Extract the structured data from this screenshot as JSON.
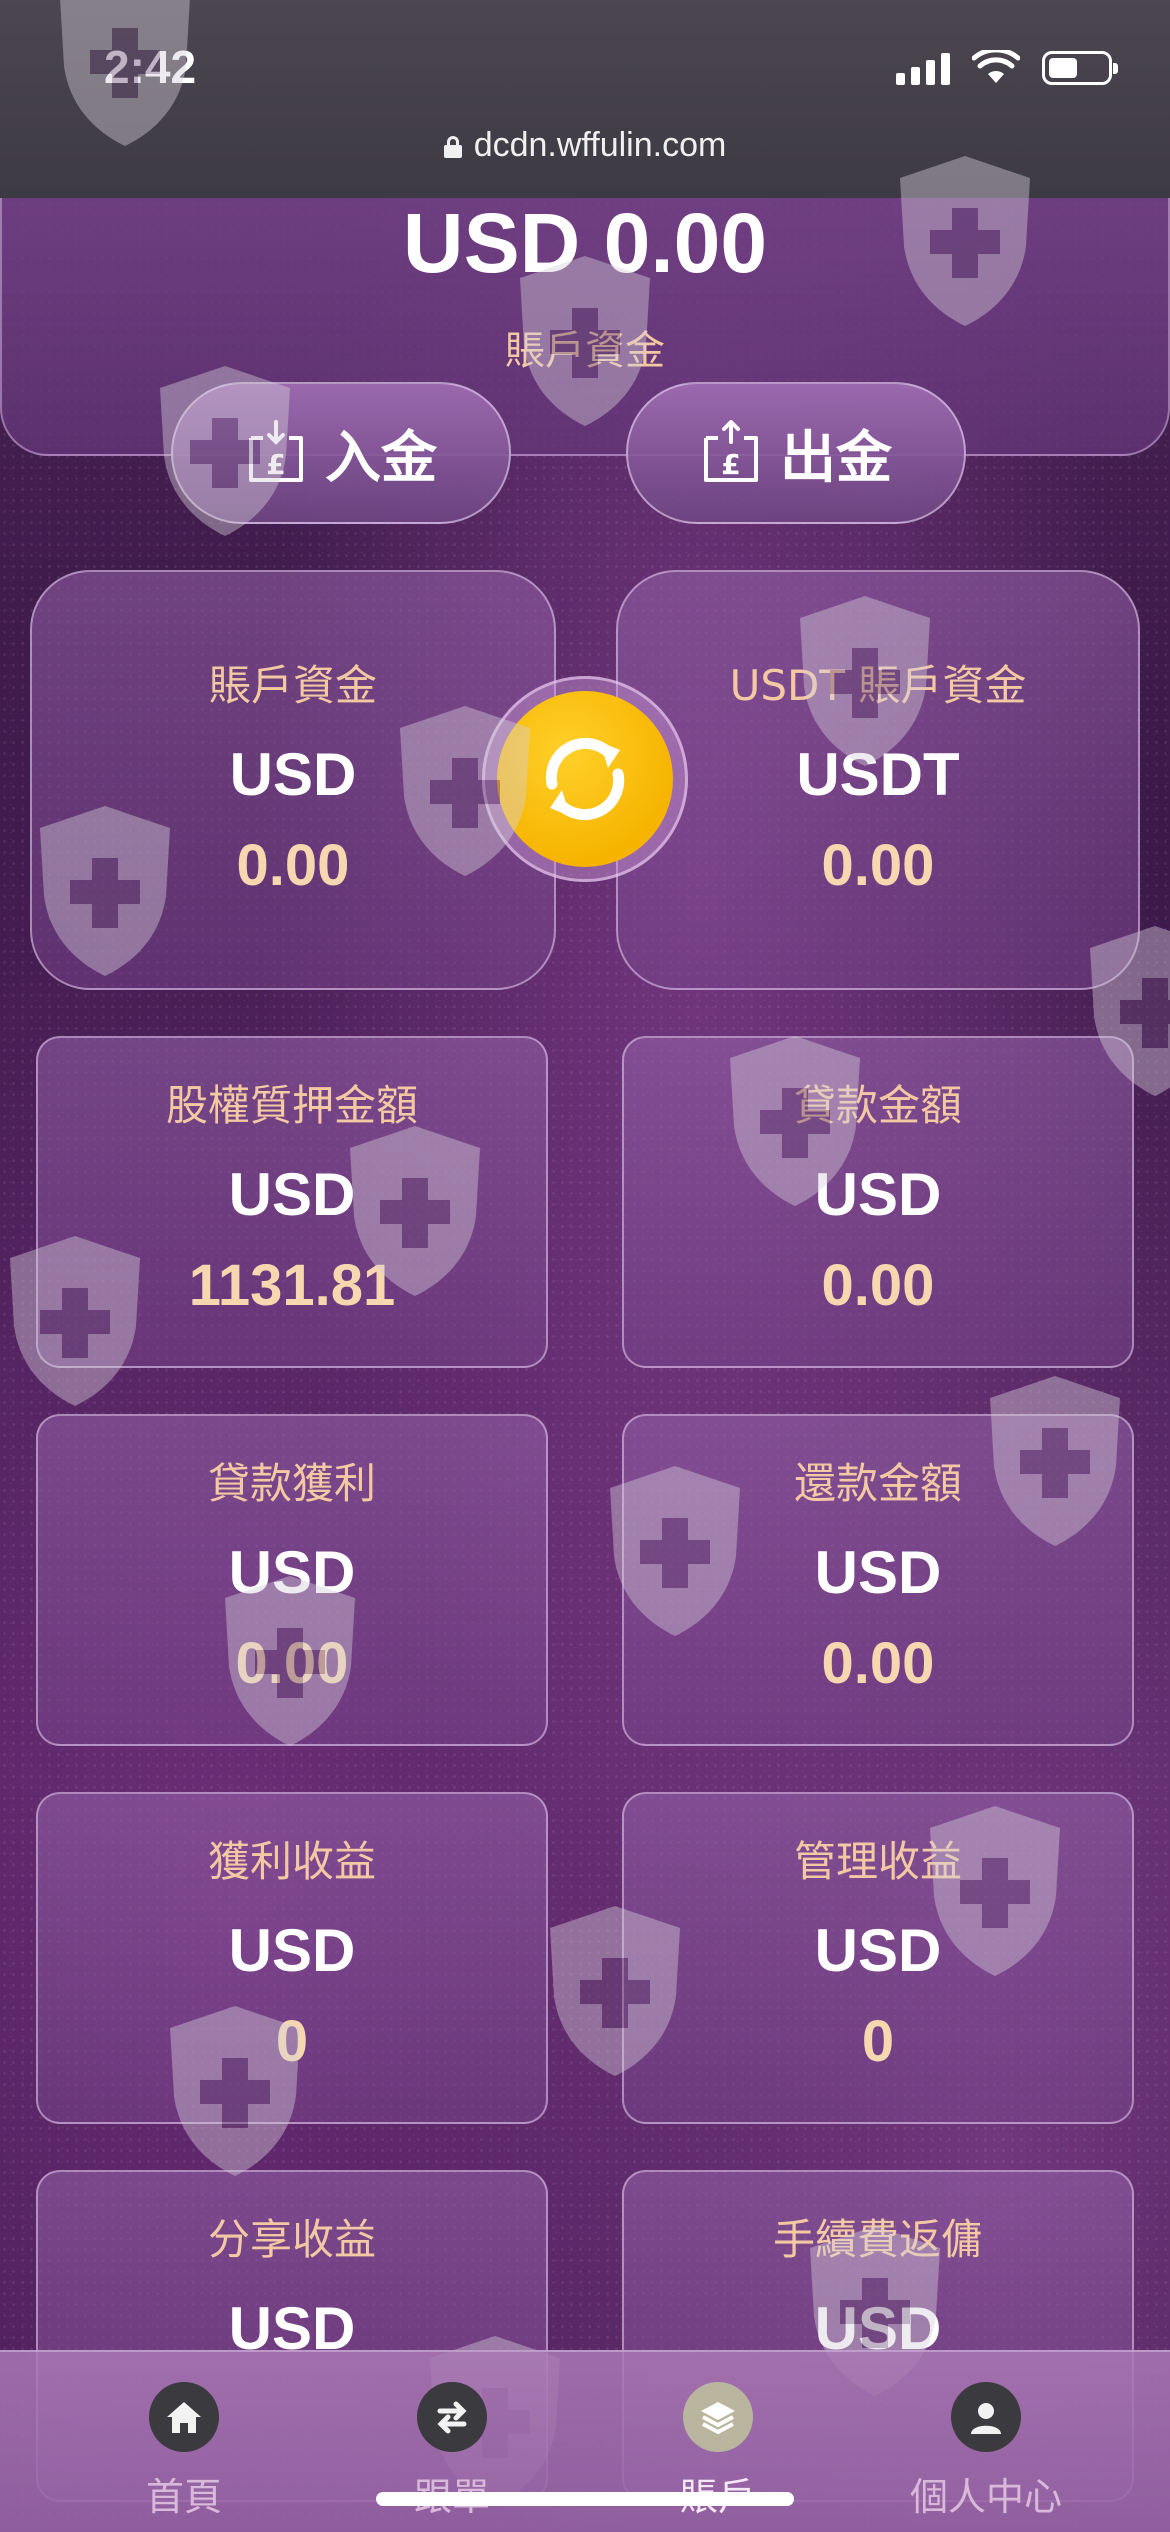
{
  "status_bar": {
    "time": "2:42"
  },
  "browser": {
    "url": "dcdn.wffulin.com"
  },
  "balance": {
    "amount": "USD 0.00",
    "label": "賬戶資金"
  },
  "actions": {
    "deposit_label": "入金",
    "withdraw_label": "出金"
  },
  "cards": [
    {
      "title": "賬戶資金",
      "currency": "USD",
      "value": "0.00"
    },
    {
      "title": "USDT 賬戶資金",
      "currency": "USDT",
      "value": "0.00"
    },
    {
      "title": "股權質押金額",
      "currency": "USD",
      "value": "1131.81"
    },
    {
      "title": "貸款金額",
      "currency": "USD",
      "value": "0.00"
    },
    {
      "title": "貸款獲利",
      "currency": "USD",
      "value": "0.00"
    },
    {
      "title": "還款金額",
      "currency": "USD",
      "value": "0.00"
    },
    {
      "title": "獲利收益",
      "currency": "USD",
      "value": "0"
    },
    {
      "title": "管理收益",
      "currency": "USD",
      "value": "0"
    },
    {
      "title": "分享收益",
      "currency": "USD",
      "value": ""
    },
    {
      "title": "手續費返傭",
      "currency": "USD",
      "value": ""
    }
  ],
  "nav": [
    {
      "label": "首頁",
      "icon": "home-icon"
    },
    {
      "label": "跟單",
      "icon": "swap-arrows-icon"
    },
    {
      "label": "賬戶",
      "icon": "layers-icon"
    },
    {
      "label": "個人中心",
      "icon": "user-icon"
    }
  ],
  "colors": {
    "accent": "#f6b400",
    "title_text": "#f3c9a4",
    "bg": "#3b1848"
  }
}
